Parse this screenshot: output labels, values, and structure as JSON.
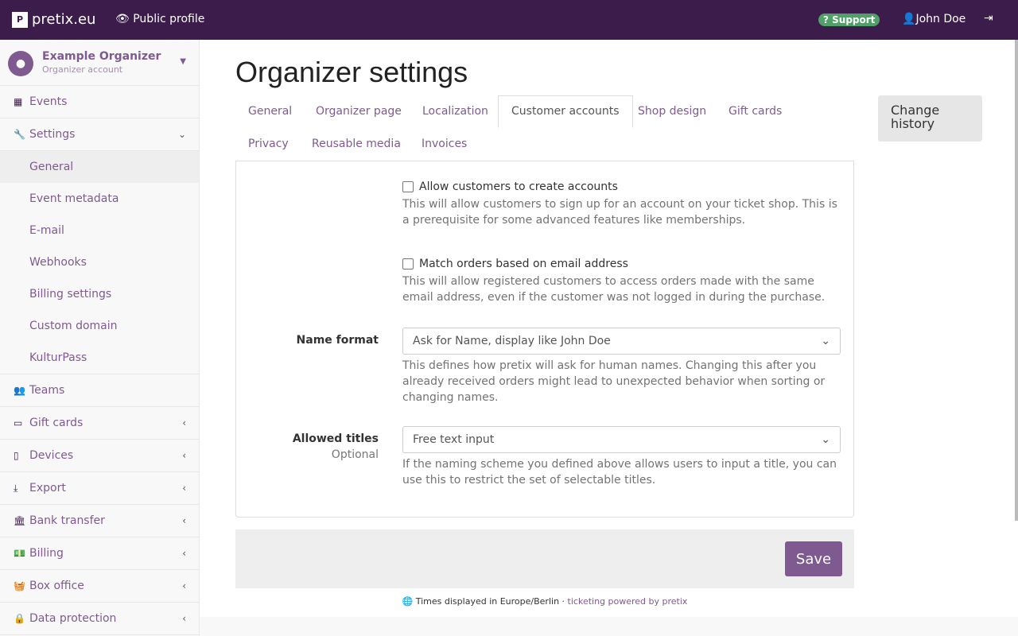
{
  "topbar": {
    "brand": "pretix.eu",
    "logo_letter": "P",
    "public_profile": "Public profile",
    "support": "Support",
    "user": "John Doe"
  },
  "sidebar": {
    "org_name": "Example Organizer",
    "org_sub": "Organizer account",
    "events": "Events",
    "settings": "Settings",
    "settings_items": [
      "General",
      "Event metadata",
      "E-mail",
      "Webhooks",
      "Billing settings",
      "Custom domain",
      "KulturPass"
    ],
    "items": [
      {
        "label": "Teams",
        "icon": "users-icon",
        "chevron": false
      },
      {
        "label": "Gift cards",
        "icon": "credit-card-icon",
        "chevron": true
      },
      {
        "label": "Devices",
        "icon": "tablet-icon",
        "chevron": true
      },
      {
        "label": "Export",
        "icon": "download-icon",
        "chevron": true
      },
      {
        "label": "Bank transfer",
        "icon": "bank-icon",
        "chevron": true
      },
      {
        "label": "Billing",
        "icon": "money-icon",
        "chevron": true
      },
      {
        "label": "Box office",
        "icon": "basket-icon",
        "chevron": true
      },
      {
        "label": "Data protection",
        "icon": "lock-icon",
        "chevron": true
      }
    ]
  },
  "main": {
    "title": "Organizer settings",
    "tabs": [
      "General",
      "Organizer page",
      "Localization",
      "Customer accounts",
      "Shop design",
      "Gift cards",
      "Privacy",
      "Reusable media",
      "Invoices"
    ],
    "active_tab": "Customer accounts",
    "change_history": "Change history",
    "form": {
      "allow_accounts": {
        "label": "Allow customers to create accounts",
        "checked": false,
        "help": "This will allow customers to sign up for an account on your ticket shop. This is a prerequisite for some advanced features like memberships."
      },
      "match_orders": {
        "label": "Match orders based on email address",
        "checked": false,
        "help": "This will allow registered customers to access orders made with the same email address, even if the customer was not logged in during the purchase."
      },
      "name_format": {
        "label": "Name format",
        "value": "Ask for Name, display like John Doe",
        "help": "This defines how pretix will ask for human names. Changing this after you already received orders might lead to unexpected behavior when sorting or changing names."
      },
      "allowed_titles": {
        "label": "Allowed titles",
        "optional": "Optional",
        "value": "Free text input",
        "help": "If the naming scheme you defined above allows users to input a title, you can use this to restrict the set of selectable titles."
      }
    },
    "save": "Save"
  },
  "footer": {
    "timezone": "Times displayed in Europe/Berlin",
    "sep": " · ",
    "powered": "ticketing powered by pretix"
  },
  "colors": {
    "header": "#3b1c4a",
    "accent": "#7f5a91",
    "support": "#50a167"
  }
}
